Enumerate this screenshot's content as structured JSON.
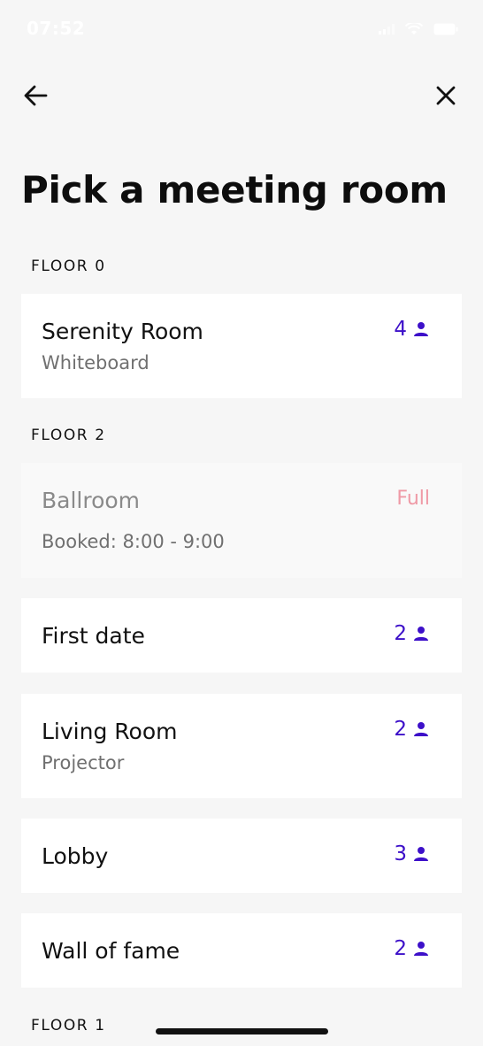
{
  "status_bar": {
    "time": "07:52"
  },
  "header": {
    "title": "Pick a meeting room"
  },
  "sections": [
    {
      "floor": "FLOOR 0",
      "rooms": [
        {
          "name": "Serenity Room",
          "detail": "Whiteboard",
          "capacity": "4"
        }
      ]
    },
    {
      "floor": "FLOOR 2",
      "rooms": [
        {
          "name": "Ballroom",
          "detail": "Booked: 8:00 - 9:00",
          "status": "Full"
        },
        {
          "name": "First date",
          "capacity": "2"
        },
        {
          "name": "Living Room",
          "detail": "Projector",
          "capacity": "2"
        },
        {
          "name": "Lobby",
          "capacity": "3"
        },
        {
          "name": "Wall of fame",
          "capacity": "2"
        }
      ]
    },
    {
      "floor": "FLOOR 1",
      "rooms": []
    }
  ],
  "colors": {
    "accent": "#3d10c9",
    "full": "#ef9aa6",
    "background": "#f6f6f6"
  },
  "icons": {
    "back": "arrow-left-icon",
    "close": "close-icon",
    "capacity": "person-icon"
  }
}
